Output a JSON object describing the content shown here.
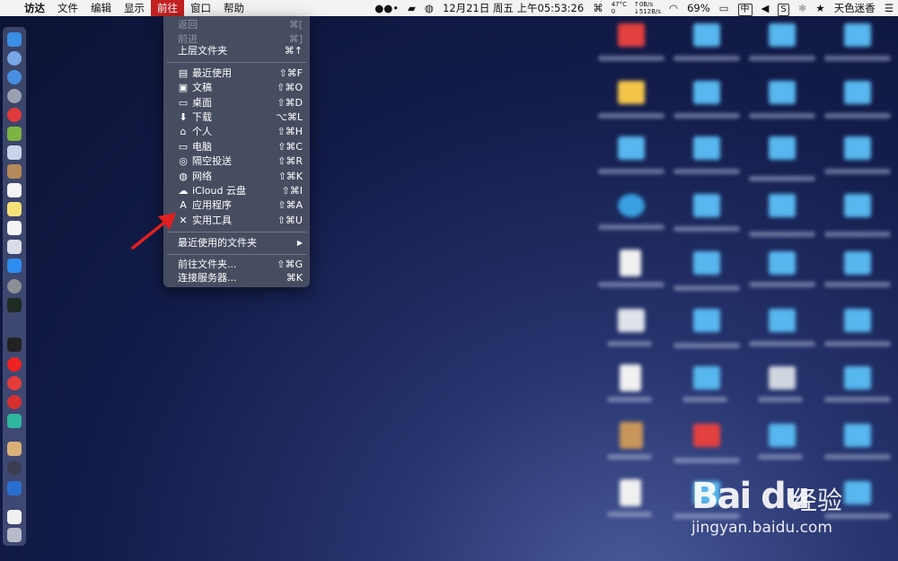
{
  "menubar": {
    "apple": "",
    "items": [
      "访达",
      "文件",
      "编辑",
      "显示",
      "前往",
      "窗口",
      "帮助"
    ],
    "active_index": 4,
    "status": {
      "temp": "47°C",
      "temp_sub": "0",
      "net_up": "↑0B/s",
      "net_down": "↓512B/s",
      "datetime": "12月21日 周五 上午05:53:26",
      "battery": "69%",
      "ime": "中",
      "user": "天色迷香"
    }
  },
  "go_menu": {
    "back": {
      "label": "返回",
      "shortcut": "⌘["
    },
    "forward": {
      "label": "前进",
      "shortcut": "⌘]"
    },
    "enclosing": {
      "label": "上层文件夹",
      "shortcut": "⌘↑"
    },
    "places": [
      {
        "icon": "recents-icon",
        "glyph": "▤",
        "label": "最近使用",
        "shortcut": "⇧⌘F"
      },
      {
        "icon": "documents-icon",
        "glyph": "▣",
        "label": "文稿",
        "shortcut": "⇧⌘O"
      },
      {
        "icon": "desktop-icon",
        "glyph": "▭",
        "label": "桌面",
        "shortcut": "⇧⌘D"
      },
      {
        "icon": "downloads-icon",
        "glyph": "⬇",
        "label": "下载",
        "shortcut": "⌥⌘L"
      },
      {
        "icon": "home-icon",
        "glyph": "⌂",
        "label": "个人",
        "shortcut": "⇧⌘H"
      },
      {
        "icon": "computer-icon",
        "glyph": "▭",
        "label": "电脑",
        "shortcut": "⇧⌘C"
      },
      {
        "icon": "airdrop-icon",
        "glyph": "◎",
        "label": "隔空投送",
        "shortcut": "⇧⌘R"
      },
      {
        "icon": "network-icon",
        "glyph": "◍",
        "label": "网络",
        "shortcut": "⇧⌘K"
      },
      {
        "icon": "icloud-icon",
        "glyph": "☁",
        "label": "iCloud 云盘",
        "shortcut": "⇧⌘I"
      },
      {
        "icon": "applications-icon",
        "glyph": "A",
        "label": "应用程序",
        "shortcut": "⇧⌘A"
      },
      {
        "icon": "utilities-icon",
        "glyph": "✕",
        "label": "实用工具",
        "shortcut": "⇧⌘U"
      }
    ],
    "recent_folders": {
      "label": "最近使用的文件夹",
      "shortcut": "▶"
    },
    "go_to_folder": {
      "label": "前往文件夹...",
      "shortcut": "⇧⌘G"
    },
    "connect_server": {
      "label": "连接服务器...",
      "shortcut": "⌘K"
    }
  },
  "watermark": {
    "logo": "Bai du",
    "cn": "经验",
    "url": "jingyan.baidu.com"
  },
  "colors": {
    "active_menu": "#c32121",
    "menu_bg": "#4a5062",
    "arrow": "#e02020"
  }
}
